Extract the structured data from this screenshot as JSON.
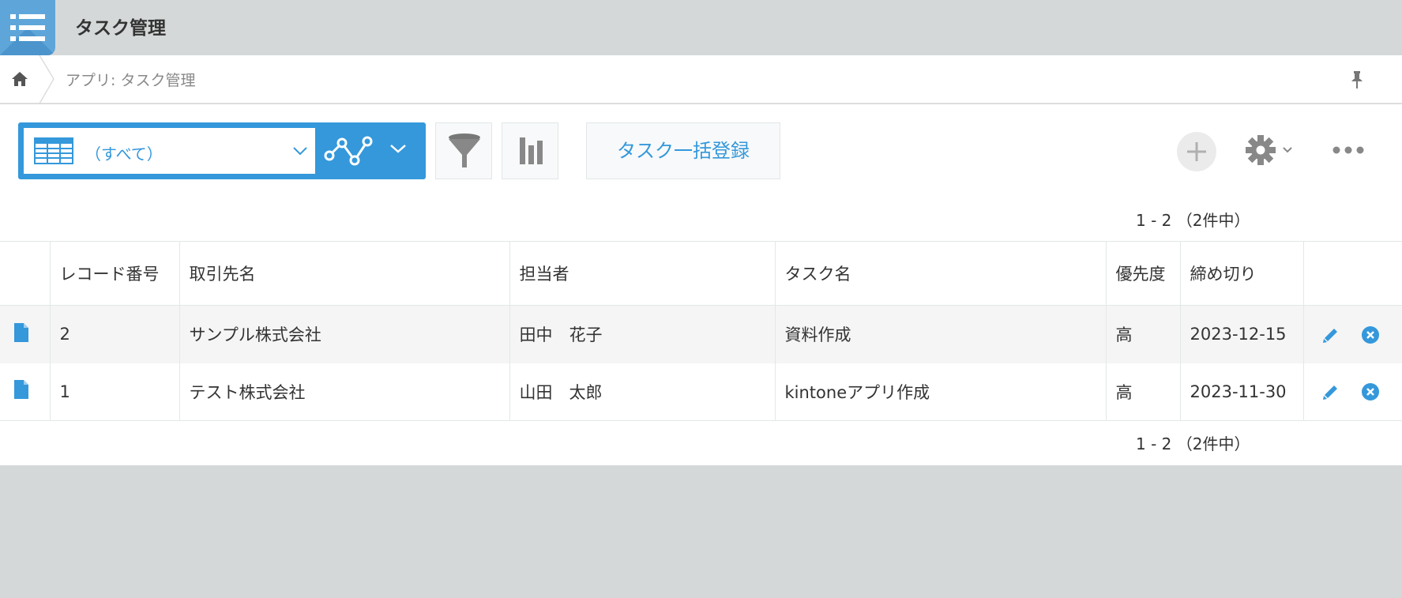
{
  "app": {
    "title": "タスク管理"
  },
  "breadcrumb": {
    "path": "アプリ: タスク管理"
  },
  "toolbar": {
    "view_label": "（すべて）",
    "bulk_button": "タスク一括登録"
  },
  "pagination": {
    "text": "1 - 2 （2件中）"
  },
  "table": {
    "headers": [
      "レコード番号",
      "取引先名",
      "担当者",
      "タスク名",
      "優先度",
      "締め切り"
    ],
    "rows": [
      {
        "record_no": "2",
        "client": "サンプル株式会社",
        "assignee": "田中　花子",
        "task": "資料作成",
        "priority": "高",
        "deadline": "2023-12-15"
      },
      {
        "record_no": "1",
        "client": "テスト株式会社",
        "assignee": "山田　太郎",
        "task": "kintoneアプリ作成",
        "priority": "高",
        "deadline": "2023-11-30"
      }
    ]
  },
  "colors": {
    "accent": "#3498db",
    "header_bg": "#d5d8d9",
    "app_icon": "#5ea6d9"
  }
}
